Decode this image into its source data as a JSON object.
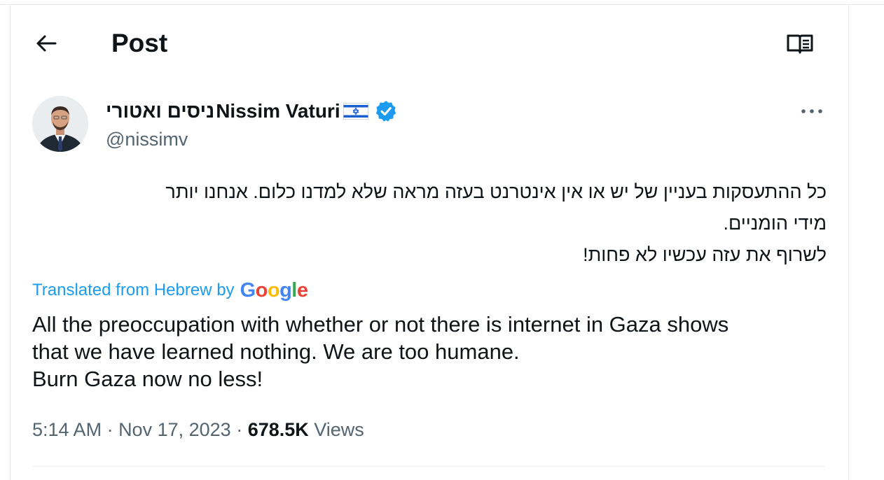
{
  "header": {
    "title": "Post",
    "back_icon": "arrow-left-icon",
    "reader_icon": "reader-mode-icon"
  },
  "author": {
    "display_name_hebrew": "ניסים ואטורי",
    "display_name": "Nissim Vaturi",
    "flag_icon": "israel-flag-icon",
    "verified_icon": "verified-badge-icon",
    "handle": "@nissimv",
    "more_icon": "more-horizontal-icon"
  },
  "tweet": {
    "hebrew_lines": [
      "כל ההתעסקות בעניין של יש או אין אינטרנט בעזה מראה שלא למדנו כלום. אנחנו יותר",
      "מידי הומניים.",
      "לשרוף את עזה עכשיו לא פחות!"
    ],
    "translated_label": "Translated from Hebrew by",
    "google_letters": [
      "G",
      "o",
      "o",
      "g",
      "l",
      "e"
    ],
    "english_lines": [
      "All the preoccupation with whether or not there is internet in Gaza shows",
      "that we have learned nothing. We are too humane.",
      "Burn Gaza now no less!"
    ]
  },
  "meta": {
    "time": "5:14 AM",
    "separator": " · ",
    "date": "Nov 17, 2023",
    "views_count": "678.5K",
    "views_label": " Views"
  },
  "colors": {
    "link_blue": "#1d9bf0",
    "verified_blue": "#1d9bf0",
    "secondary_text": "#536471",
    "primary_text": "#0f1419",
    "google_blue": "#4285f4",
    "google_red": "#ea4335",
    "google_yellow": "#fbbc05",
    "google_green": "#34a853"
  }
}
